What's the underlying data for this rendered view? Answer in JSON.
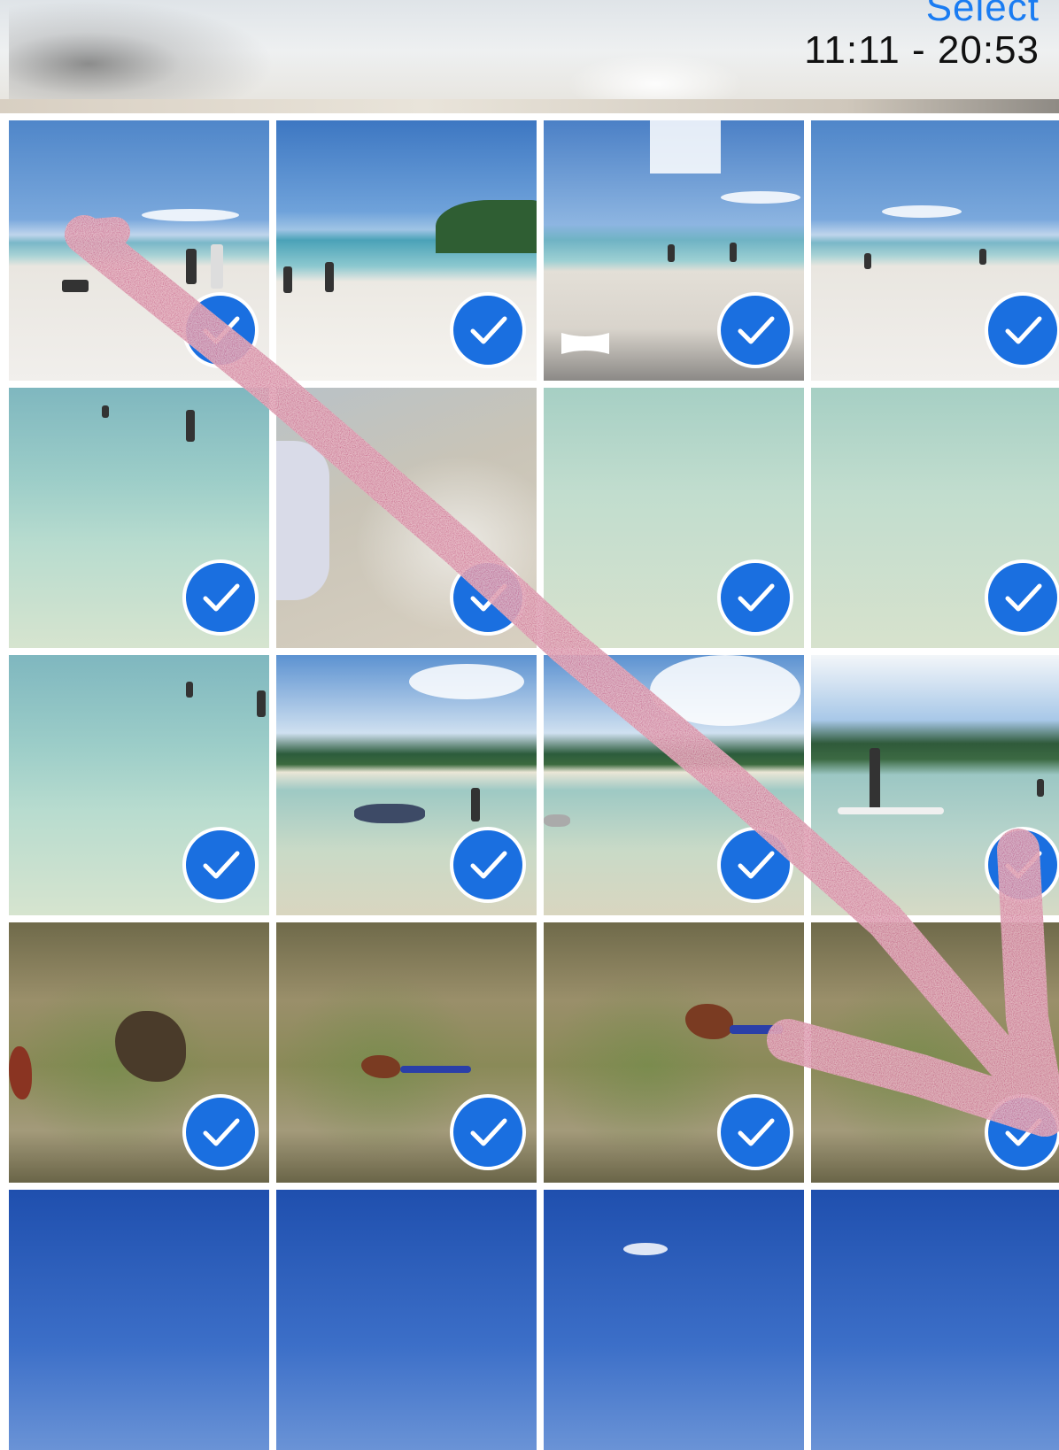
{
  "header": {
    "select_label": "Select",
    "time_range": "11:11 - 20:53"
  },
  "accent_color": "#1a7cf2",
  "checkmark_color": "#1a6fe0",
  "photos": [
    {
      "scene": "beach",
      "selected": true
    },
    {
      "scene": "beach",
      "selected": true
    },
    {
      "scene": "beach-panorama",
      "selected": true,
      "icon": "panorama-icon"
    },
    {
      "scene": "beach",
      "selected": true
    },
    {
      "scene": "water",
      "selected": true
    },
    {
      "scene": "water",
      "selected": true
    },
    {
      "scene": "water",
      "selected": true
    },
    {
      "scene": "water",
      "selected": true
    },
    {
      "scene": "water",
      "selected": true
    },
    {
      "scene": "lake",
      "selected": true
    },
    {
      "scene": "lake",
      "selected": true
    },
    {
      "scene": "lake",
      "selected": true
    },
    {
      "scene": "grass",
      "selected": true
    },
    {
      "scene": "grass",
      "selected": true
    },
    {
      "scene": "grass",
      "selected": true
    },
    {
      "scene": "grass",
      "selected": true
    },
    {
      "scene": "sky",
      "selected": false
    },
    {
      "scene": "sky",
      "selected": false
    },
    {
      "scene": "sky",
      "selected": false
    },
    {
      "scene": "sky",
      "selected": false
    }
  ],
  "annotation": {
    "type": "hand-drawn arrow",
    "color": "#c9728a"
  }
}
